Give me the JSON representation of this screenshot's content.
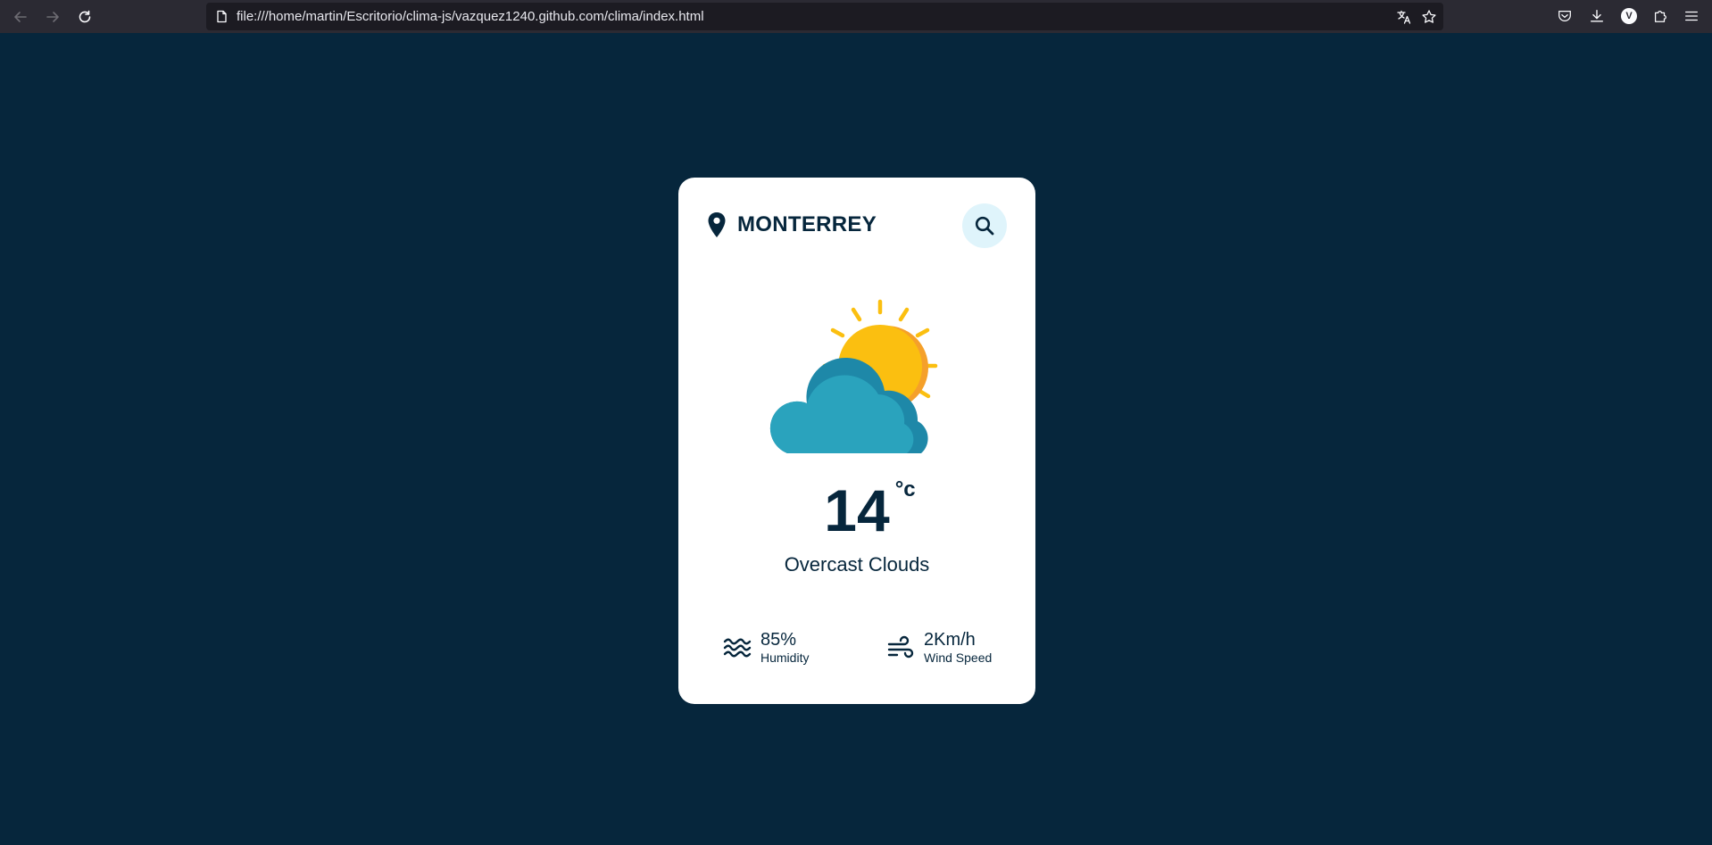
{
  "browser": {
    "url": "file:///home/martin/Escritorio/clima-js/vazquez1240.github.com/clima/index.html",
    "profile_initial": "V"
  },
  "weather": {
    "city": "MONTERREY",
    "temperature": "14",
    "unit": "°c",
    "description": "Overcast Clouds",
    "humidity": {
      "value": "85%",
      "label": "Humidity"
    },
    "wind": {
      "value": "2Km/h",
      "label": "Wind Speed"
    }
  },
  "colors": {
    "background": "#06263c",
    "card": "#ffffff",
    "text": "#06263c",
    "search_bg": "#dff4fb",
    "sun": "#fbbf10",
    "cloud": "#2aa3bd"
  },
  "icons": {
    "back": "arrow-left-icon",
    "forward": "arrow-right-icon",
    "reload": "reload-icon",
    "location": "map-pin-icon",
    "search": "search-icon",
    "weather": "partly-cloudy-icon",
    "humidity": "waves-icon",
    "wind": "wind-icon"
  }
}
